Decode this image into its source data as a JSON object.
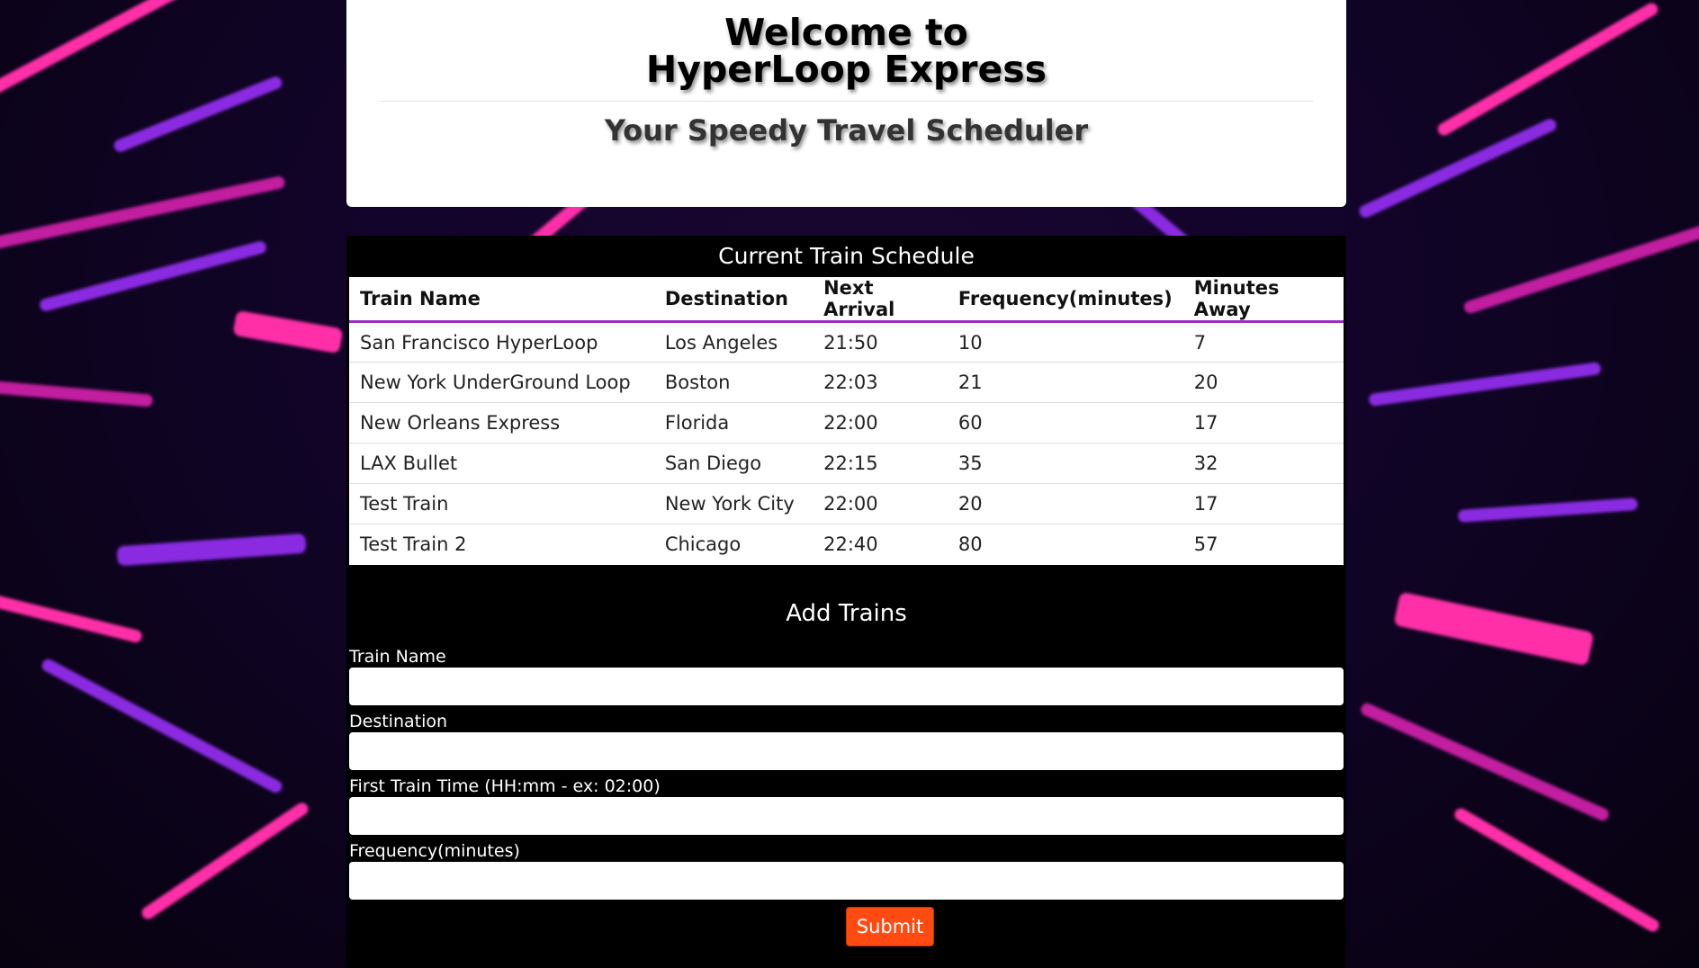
{
  "header": {
    "title_line1": "Welcome to",
    "title_line2": "HyperLoop Express",
    "subtitle": "Your Speedy Travel Scheduler"
  },
  "schedule": {
    "title": "Current Train Schedule",
    "columns": [
      "Train Name",
      "Destination",
      "Next Arrival",
      "Frequency(minutes)",
      "Minutes Away"
    ],
    "rows": [
      [
        "San Francisco HyperLoop",
        "Los Angeles",
        "21:50",
        "10",
        "7"
      ],
      [
        "New York UnderGround Loop",
        "Boston",
        "22:03",
        "21",
        "20"
      ],
      [
        "New Orleans Express",
        "Florida",
        "22:00",
        "60",
        "17"
      ],
      [
        "LAX Bullet",
        "San Diego",
        "22:15",
        "35",
        "32"
      ],
      [
        "Test Train",
        "New York City",
        "22:00",
        "20",
        "17"
      ],
      [
        "Test Train 2",
        "Chicago",
        "22:40",
        "80",
        "57"
      ]
    ]
  },
  "form": {
    "title": "Add Trains",
    "labels": {
      "train_name": "Train Name",
      "destination": "Destination",
      "first_time": "First Train Time (HH:mm - ex: 02:00)",
      "frequency": "Frequency(minutes)"
    },
    "submit_label": "Submit"
  },
  "colors": {
    "accent": "#9b2fbf",
    "submit": "#ff4a12",
    "streak_pink": "#ff2fa8",
    "streak_purple": "#8a2be2"
  }
}
